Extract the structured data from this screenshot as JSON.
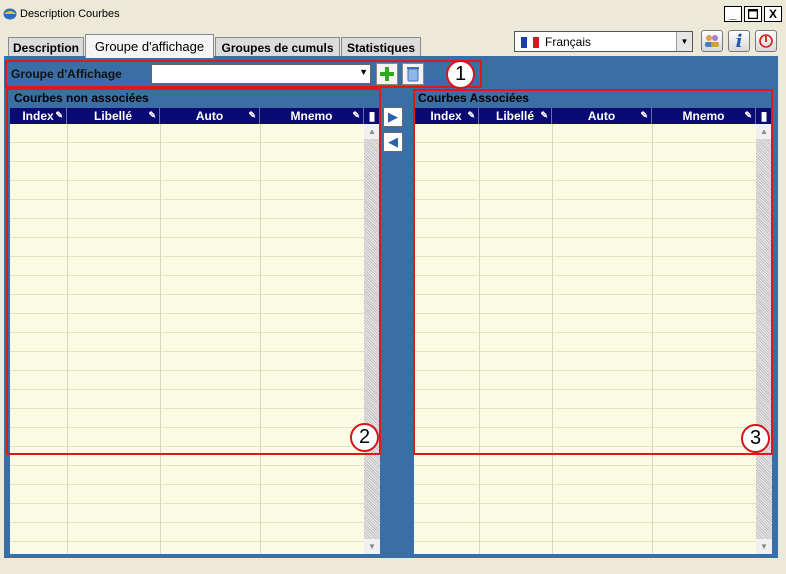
{
  "window": {
    "title": "Description Courbes",
    "minimize_label": "_",
    "maximize_label": "☐",
    "close_label": "X"
  },
  "tabs": [
    {
      "label": "Description",
      "active": false
    },
    {
      "label": "Groupe d'affichage",
      "active": true
    },
    {
      "label": "Groupes de cumuls",
      "active": false
    },
    {
      "label": "Statistiques",
      "active": false
    }
  ],
  "language": {
    "selected": "Français",
    "flag_colors": [
      "#1a3fa8",
      "#ffffff",
      "#d41b1b"
    ]
  },
  "toolbar": {
    "icons": [
      "users-icon",
      "info-icon",
      "power-icon"
    ]
  },
  "group": {
    "label": "Groupe d'Affichage",
    "value": ""
  },
  "left_panel": {
    "title": "Courbes non associées",
    "columns": [
      "Index",
      "Libellé",
      "Auto",
      "Mnemo"
    ]
  },
  "right_panel": {
    "title": "Courbes Associées",
    "columns": [
      "Index",
      "Libellé",
      "Auto",
      "Mnemo"
    ]
  },
  "annotations": [
    "1",
    "2",
    "3"
  ],
  "colors": {
    "panel_background": "#3a6ea5",
    "grid_header": "#0a0a73",
    "annotation_red": "#e01818"
  }
}
